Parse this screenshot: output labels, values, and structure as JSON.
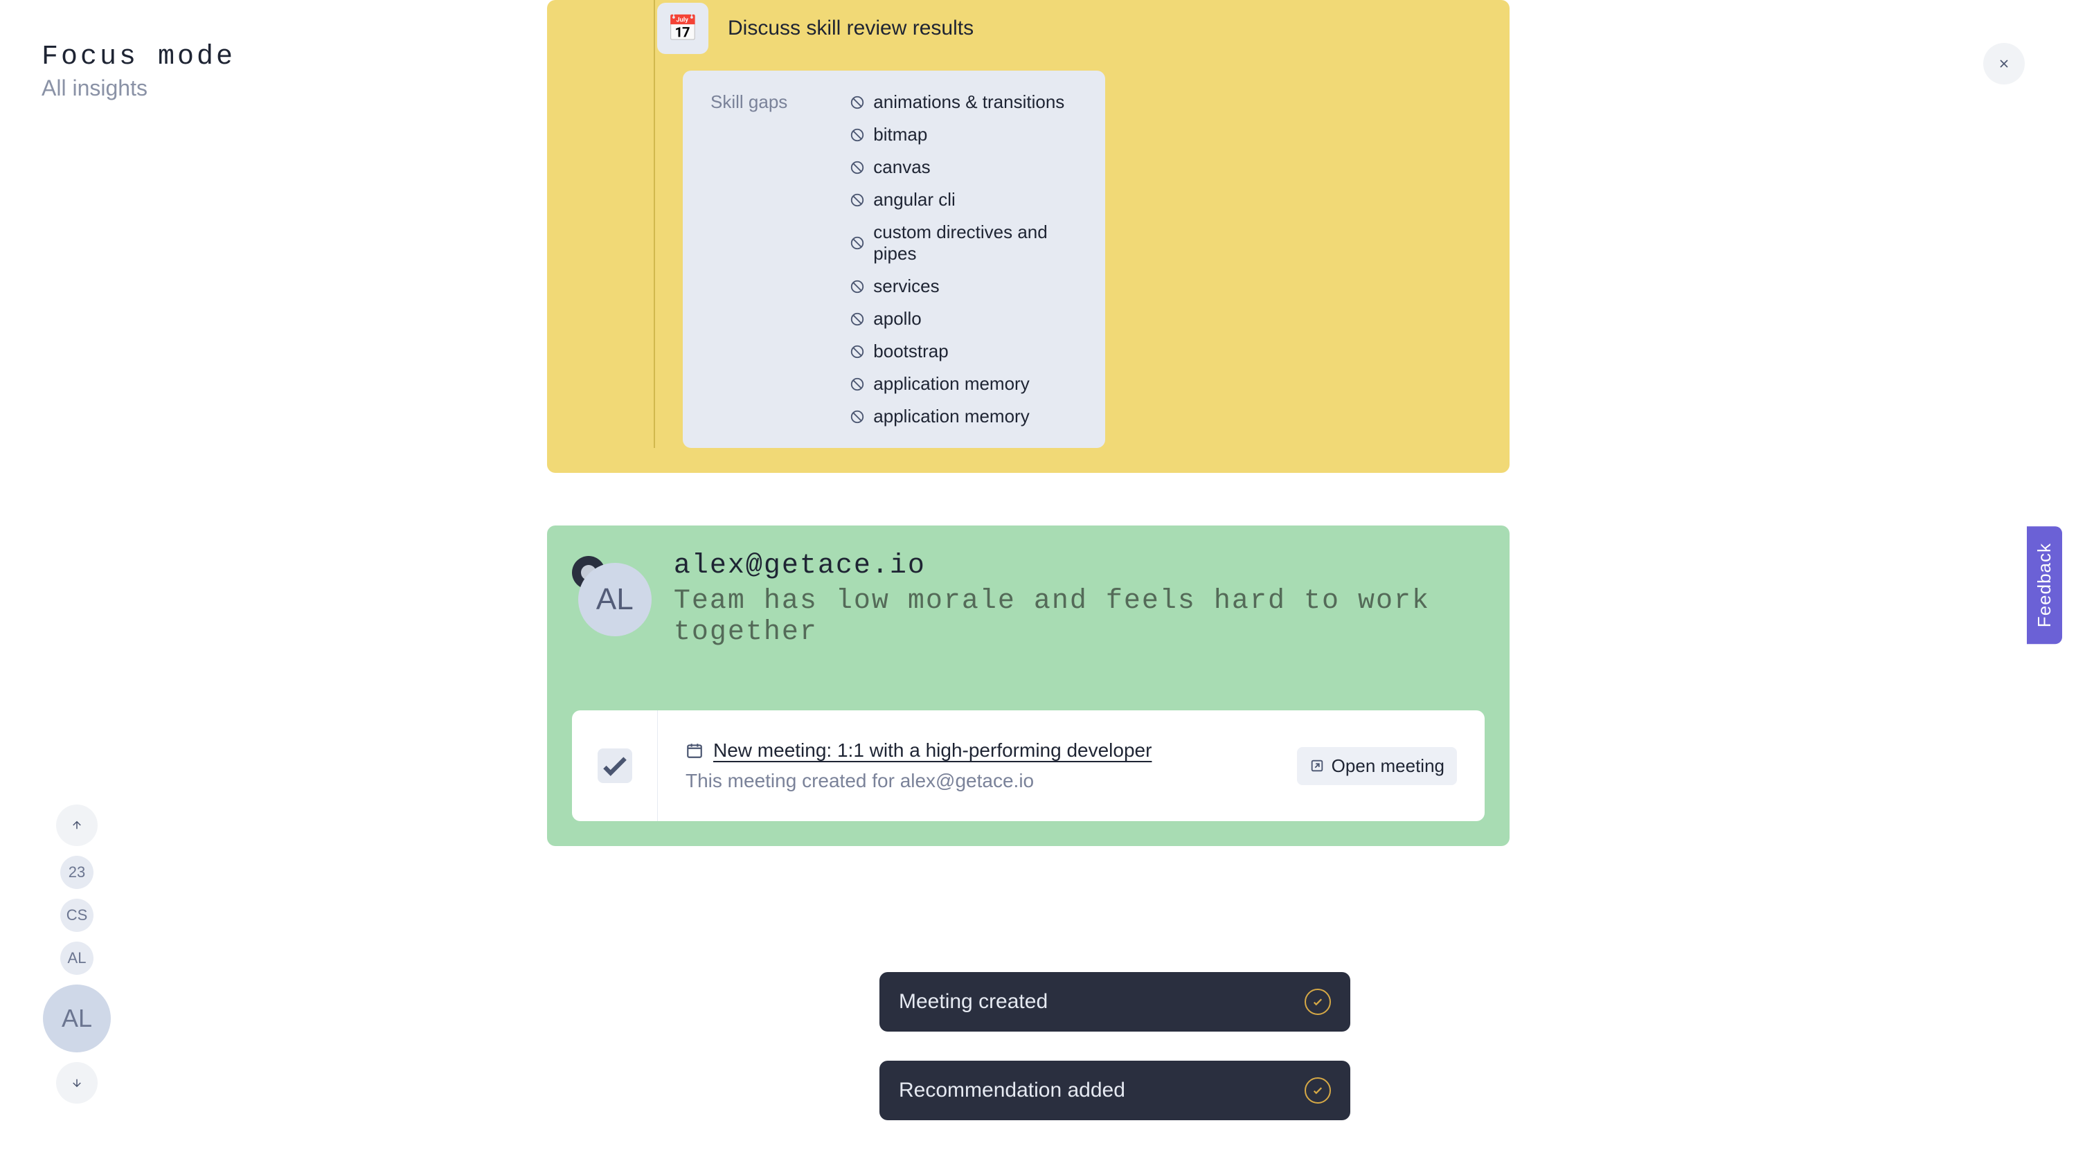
{
  "header": {
    "title": "Focus mode",
    "subtitle": "All insights"
  },
  "nav": {
    "items": [
      {
        "label": "23"
      },
      {
        "label": "CS"
      },
      {
        "label": "AL"
      }
    ],
    "active": {
      "label": "AL"
    }
  },
  "card1": {
    "action_label": "Discuss skill review results",
    "action_icon": "📅",
    "skill_box_title": "Skill gaps",
    "skills": [
      "animations & transitions",
      "bitmap",
      "canvas",
      "angular cli",
      "custom directives and pipes",
      "services",
      "apollo",
      "bootstrap",
      "application memory",
      "application memory"
    ]
  },
  "card2": {
    "avatar_initials": "AL",
    "email": "alex@getace.io",
    "subtitle": "Team has low morale and feels hard to work together",
    "meeting": {
      "link_text": "New meeting: 1:1 with a high-performing developer",
      "desc": "This meeting created for alex@getace.io",
      "open_label": "Open meeting"
    }
  },
  "toasts": [
    {
      "text": "Meeting created"
    },
    {
      "text": "Recommendation added"
    }
  ],
  "feedback_label": "Feedback"
}
